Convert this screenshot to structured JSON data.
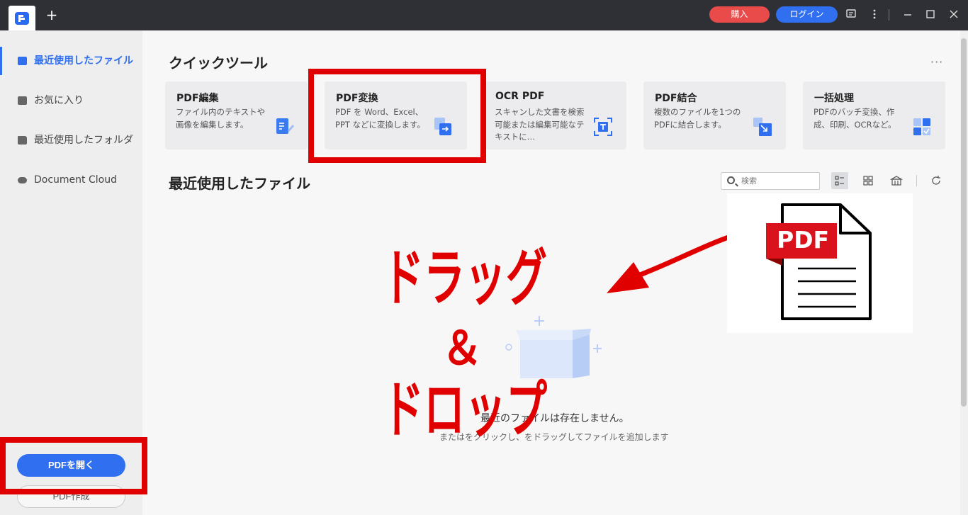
{
  "titlebar": {
    "new_tab": "+",
    "buy_label": "購入",
    "login_label": "ログイン",
    "icons": [
      "message-icon",
      "more-vertical-icon",
      "minimize-icon",
      "maximize-icon",
      "close-icon"
    ]
  },
  "sidebar": {
    "items": [
      {
        "label": "最近使用したファイル",
        "icon": "recent-file-icon",
        "active": true
      },
      {
        "label": "お気に入り",
        "icon": "star-icon",
        "active": false
      },
      {
        "label": "最近使用したフォルダ",
        "icon": "folder-icon",
        "active": false
      },
      {
        "label": "Document Cloud",
        "icon": "cloud-icon",
        "active": false
      }
    ],
    "open_button": "PDFを開く",
    "create_button": "PDF作成"
  },
  "quick_tools": {
    "heading": "クイックツール",
    "more": "···",
    "cards": [
      {
        "title": "PDF編集",
        "desc": "ファイル内のテキストや画像を編集します。",
        "icon": "edit-pdf-icon"
      },
      {
        "title": "PDF変換",
        "desc": "PDF を Word、Excel、PPT などに変換します。",
        "icon": "convert-pdf-icon"
      },
      {
        "title": "OCR PDF",
        "desc": "スキャンした文書を検索可能または編集可能なテキストに…",
        "icon": "ocr-icon"
      },
      {
        "title": "PDF結合",
        "desc": "複数のファイルを1つのPDFに結合します。",
        "icon": "merge-pdf-icon"
      },
      {
        "title": "一括処理",
        "desc": "PDFのバッチ変換、作成、印刷、OCRなど。",
        "icon": "batch-icon"
      }
    ]
  },
  "recent": {
    "heading": "最近使用したファイル",
    "search_placeholder": "検索",
    "empty_title": "最近のファイルは存在しません。",
    "empty_sub": "またはをクリックし、をドラッグしてファイルを追加します"
  },
  "overlay": {
    "drag": "ドラッグ",
    "and": "＆",
    "drop": "ドロップ",
    "pdf_label": "PDF",
    "accent": "#e00000"
  }
}
